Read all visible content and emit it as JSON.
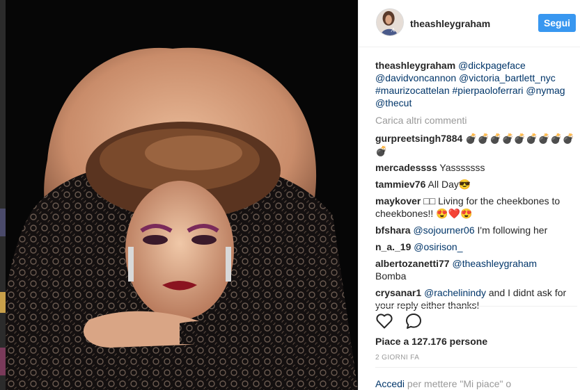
{
  "post": {
    "username": "theashleygraham",
    "follow_label": "Segui",
    "caption": {
      "user": "theashleygraham",
      "mentions": [
        "@dickpageface",
        "@davidvoncannon",
        "@victoria_bartlett_nyc"
      ],
      "tags": [
        "#maurizocattelan",
        "#pierpaoloferrari"
      ],
      "mentions2": [
        "@nymag",
        "@thecut"
      ]
    },
    "load_more": "Carica altri commenti",
    "comments": [
      {
        "user": "gurpreetsingh7884",
        "text": "💣💣💣💣💣💣💣💣💣💣"
      },
      {
        "user": "mercadessss",
        "text": "Yasssssss"
      },
      {
        "user": "tammiev76",
        "text": "All Day😎"
      },
      {
        "user": "maykover",
        "text": "□□ Living for the cheekbones to cheekbones!! 😍❤️😍"
      },
      {
        "user": "bfshara",
        "mention": "@sojourner06",
        "text": "I'm following her"
      },
      {
        "user": "n_a._19",
        "mention": "@osirison_",
        "text": ""
      },
      {
        "user": "albertozanetti77",
        "mention": "@theashleygraham",
        "text": "Bomba"
      },
      {
        "user": "crysanar1",
        "mention": "@rachelinindy",
        "text": "and I didnt ask for your reply either thanks!"
      }
    ],
    "likes_text": "Piace a 127.176 persone",
    "timestamp": "2 GIORNI FA",
    "login_link": "Accedi",
    "login_rest": "per mettere \"Mi piace\" o"
  },
  "icons": {
    "like": "heart-outline-icon",
    "comment": "speech-bubble-icon"
  },
  "colors": {
    "link": "#003569",
    "button": "#3897f0",
    "muted": "#999999",
    "text": "#262626"
  }
}
